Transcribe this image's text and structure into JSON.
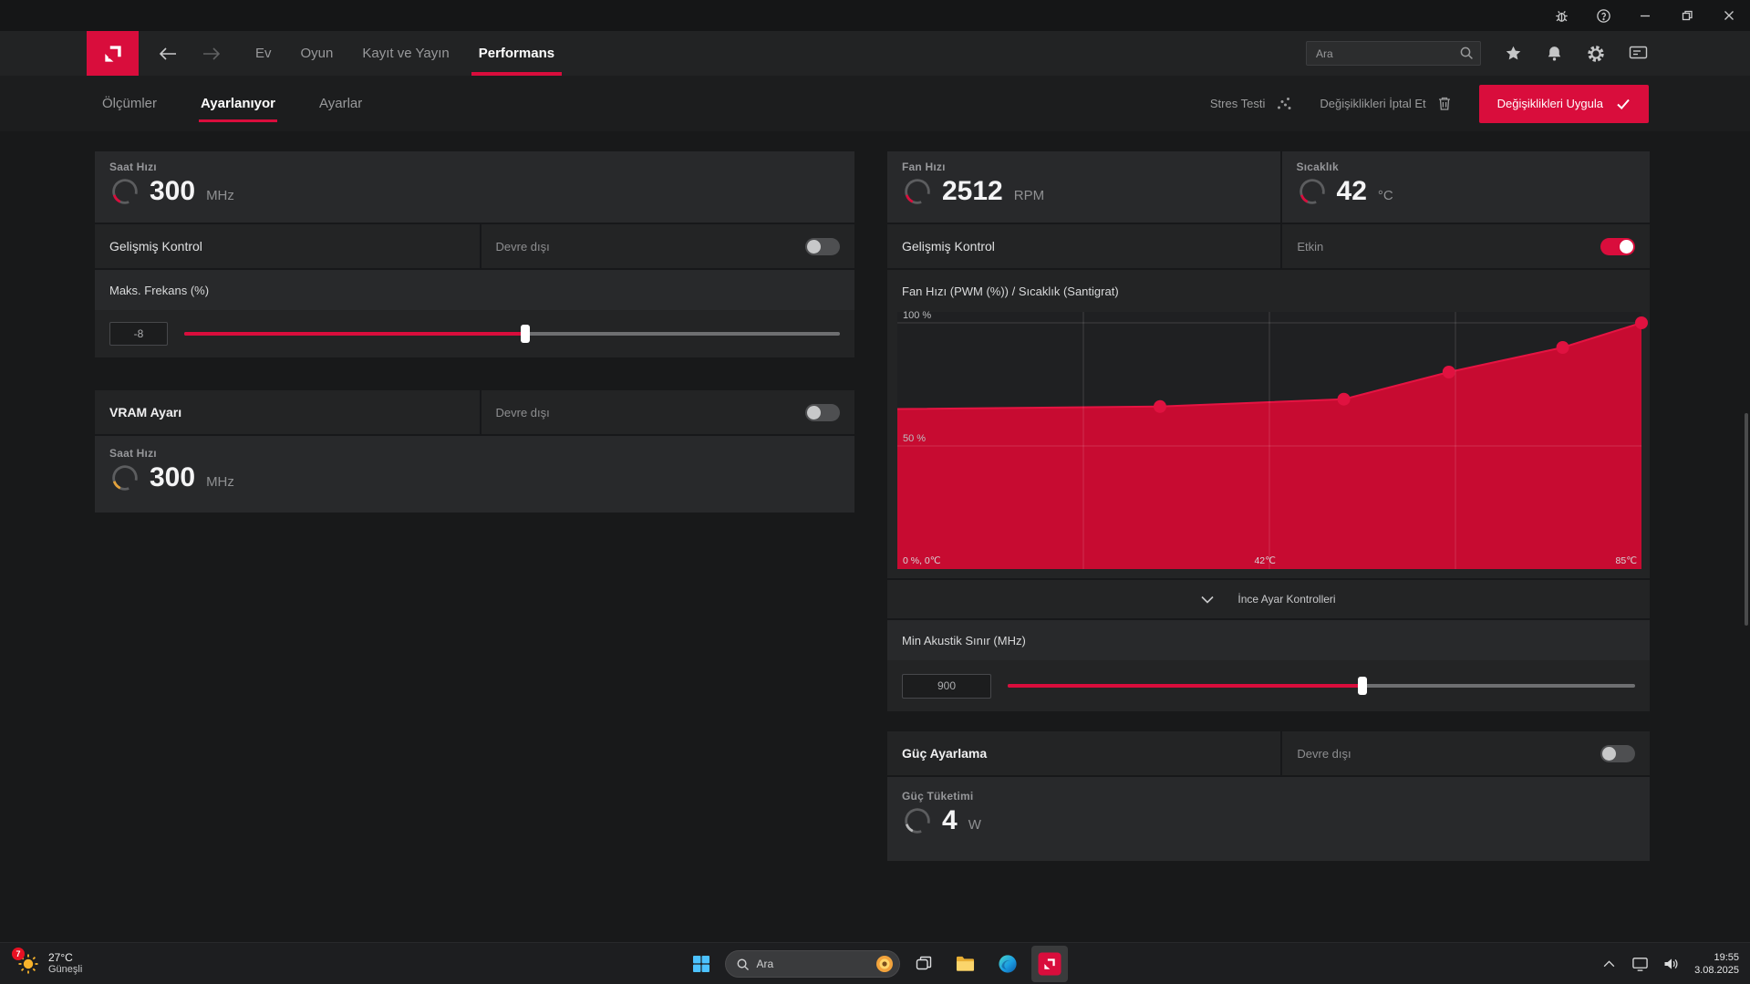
{
  "navbar": {
    "search_placeholder": "Ara",
    "items": [
      {
        "label": "Ev"
      },
      {
        "label": "Oyun"
      },
      {
        "label": "Kayıt ve Yayın"
      },
      {
        "label": "Performans"
      }
    ]
  },
  "subnav": {
    "tabs": [
      {
        "label": "Ölçümler"
      },
      {
        "label": "Ayarlanıyor"
      },
      {
        "label": "Ayarlar"
      }
    ],
    "stress_test_label": "Stres Testi",
    "discard_label": "Değişiklikleri İptal Et",
    "apply_label": "Değişiklikleri Uygula"
  },
  "left": {
    "clock": {
      "label": "Saat Hızı",
      "value": "300",
      "unit": "MHz"
    },
    "advanced": {
      "label": "Gelişmiş Kontrol",
      "state": "Devre dışı",
      "enabled": false
    },
    "max_freq_label": "Maks. Frekans (%)",
    "max_freq_value": "-8",
    "max_freq_slider_pct": 52,
    "vram": {
      "title": "VRAM Ayarı",
      "state": "Devre dışı",
      "enabled": false,
      "clock": {
        "label": "Saat Hızı",
        "value": "300",
        "unit": "MHz"
      }
    }
  },
  "right": {
    "fan": {
      "label": "Fan Hızı",
      "value": "2512",
      "unit": "RPM"
    },
    "temp": {
      "label": "Sıcaklık",
      "value": "42",
      "unit": "°C"
    },
    "advanced": {
      "label": "Gelişmiş Kontrol",
      "state": "Etkin",
      "enabled": true
    },
    "fine_tuning_label": "İnce Ayar Kontrolleri",
    "acoustic_label": "Min Akustik Sınır (MHz)",
    "acoustic_value": "900",
    "acoustic_slider_pct": 56.5,
    "power": {
      "title": "Güç Ayarlama",
      "state": "Devre dışı",
      "enabled": false,
      "consumption_label": "Güç Tüketimi",
      "value": "4",
      "unit": "W"
    }
  },
  "chart_data": {
    "type": "area",
    "title": "Fan Hızı (PWM (%)) / Sıcaklık (Santigrat)",
    "xlim": [
      0,
      85
    ],
    "ylim": [
      0,
      100
    ],
    "points": [
      {
        "temp": 0,
        "pwm": 65,
        "dot": false
      },
      {
        "temp": 30,
        "pwm": 66,
        "dot": true
      },
      {
        "temp": 51,
        "pwm": 69,
        "dot": true
      },
      {
        "temp": 63,
        "pwm": 80,
        "dot": true
      },
      {
        "temp": 76,
        "pwm": 90,
        "dot": true
      },
      {
        "temp": 85,
        "pwm": 100,
        "dot": true
      }
    ],
    "y_labels": [
      {
        "text": "100 %",
        "pwm": 100
      },
      {
        "text": "50 %",
        "pwm": 50
      }
    ],
    "x_labels": [
      {
        "text": "0 %, 0℃",
        "temp": 0,
        "align": "left"
      },
      {
        "text": "42℃",
        "temp": 42,
        "align": "center"
      },
      {
        "text": "85℃",
        "temp": 85,
        "align": "right"
      }
    ],
    "grid_x": [
      21.25,
      42.5,
      63.75
    ],
    "grid_y": [
      50,
      100
    ]
  },
  "taskbar": {
    "weather": {
      "temp": "27°C",
      "desc": "Güneşli",
      "badge": "7"
    },
    "search_placeholder": "Ara",
    "clock": {
      "time": "19:55",
      "date": "3.08.2025"
    }
  },
  "colors": {
    "accent": "#d90d3c",
    "chart_fill": "#c70b31",
    "chart_line": "#e51442",
    "chart_dot": "#e01240",
    "vram_tick": "#e3a23c",
    "power_tick": "#b9babb"
  }
}
